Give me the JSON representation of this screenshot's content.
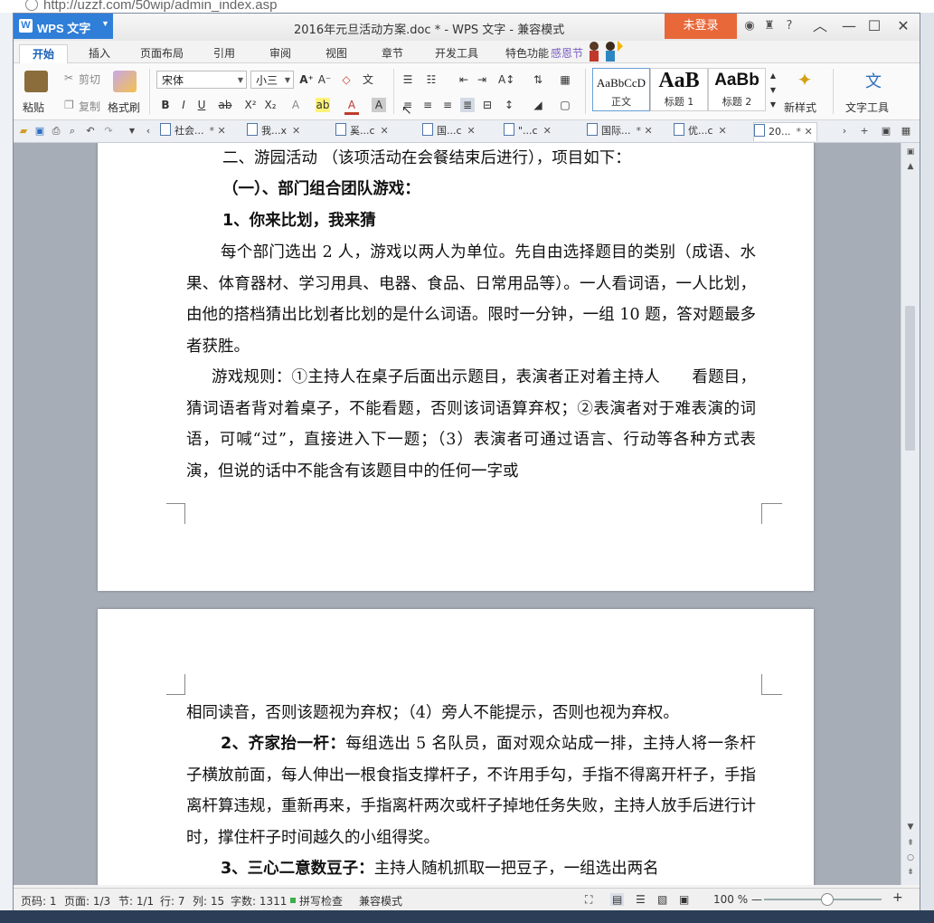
{
  "browser": {
    "url": "http://uzzf.com/50wip/admin_index.asp"
  },
  "app": {
    "name": "WPS 文字",
    "logo_letter": "W"
  },
  "window": {
    "title": "2016年元旦活动方案.doc * - WPS 文字 - 兼容模式",
    "login": "未登录"
  },
  "ribbon_tabs": [
    "开始",
    "插入",
    "页面布局",
    "引用",
    "审阅",
    "视图",
    "章节",
    "开发工具",
    "特色功能"
  ],
  "festival_label": "感恩节",
  "clipboard": {
    "paste": "粘贴",
    "cut": "剪切",
    "copy": "复制",
    "format_painter": "格式刷"
  },
  "font": {
    "family": "宋体",
    "size": "小三"
  },
  "styles": [
    {
      "preview": "AaBbCcD",
      "name": "正文"
    },
    {
      "preview": "AaB",
      "name": "标题 1"
    },
    {
      "preview": "AaBb",
      "name": "标题 2"
    }
  ],
  "new_style": "新样式",
  "text_tool": "文字工具",
  "doc_tabs": [
    "社会...",
    "我...x",
    "奚...c",
    "国...c",
    "\"...c",
    "国际...",
    "优...c",
    "20..."
  ],
  "document": {
    "p1": "二、游园活动 （该项活动在会餐结束后进行），项目如下：",
    "p2": "（一）、部门组合团队游戏：",
    "p3": "1、你来比划，我来猜",
    "p4": "每个部门选出 2 人，游戏以两人为单位。先自由选择题目的类别（成语、水果、体育器材、学习用具、电器、食品、日常用品等）。一人看词语，一人比划，由他的搭档猜出比划者比划的是什么词语。限时一分钟，一组 10 题，答对题最多者获胜。",
    "p5": "游戏规则：①主持人在桌子后面出示题目，表演者正对着主持人　　看题目，猜词语者背对着桌子，不能看题，否则该词语算弃权；②表演者对于难表演的词语，可喊“过”，直接进入下一题；（3）表演者可通过语言、行动等各种方式表演，但说的话中不能含有该题目中的任何一字或",
    "p6": "相同读音，否则该题视为弃权；（4）旁人不能提示，否则也视为弃权。",
    "p7_bold": "2、齐家抬一杆：",
    "p7_rest": "每组选出 5 名队员，面对观众站成一排，主持人将一条杆子横放前面，每人伸出一根食指支撑杆子，不许用手勾，手指不得离开杆子，手指离杆算违规，重新再来，手指离杆两次或杆子掉地任务失败，主持人放手后进行计时，撑住杆子时间越久的小组得奖。",
    "p8_bold": "3、三心二意数豆子：",
    "p8_rest": "主持人随机抓取一把豆子，一组选出两名"
  },
  "status": {
    "page": "页码: 1",
    "pages": "页面: 1/3",
    "section": "节: 1/1",
    "row": "行: 7",
    "col": "列: 15",
    "words": "字数: 1311",
    "spell": "拼写检查",
    "mode": "兼容模式",
    "zoom": "100 %"
  }
}
